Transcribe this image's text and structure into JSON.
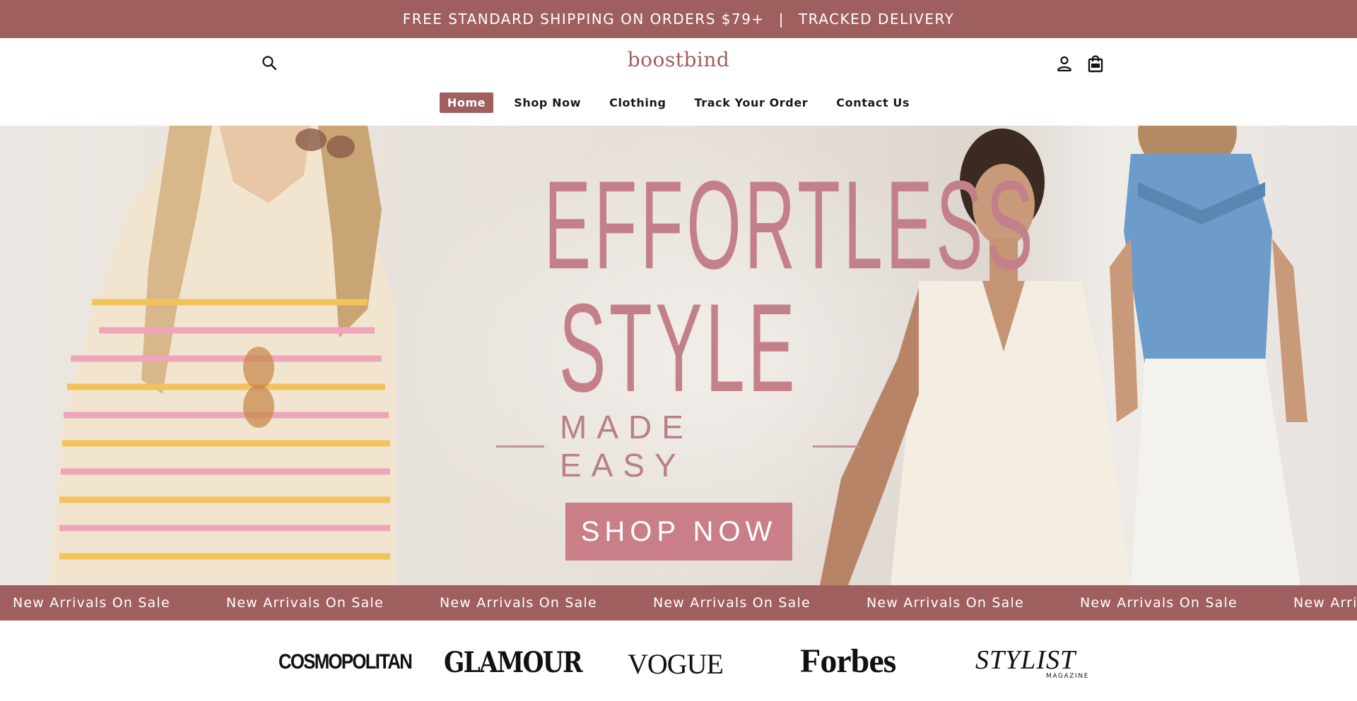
{
  "announcement": {
    "left": "FREE STANDARD SHIPPING ON ORDERS $79+",
    "separator": "|",
    "right": "TRACKED DELIVERY"
  },
  "header": {
    "logo": "boostbind",
    "icons": {
      "search": "search-icon",
      "account": "user-icon",
      "cart": "shopping-bag-icon"
    }
  },
  "nav": {
    "items": [
      {
        "label": "Home",
        "active": true
      },
      {
        "label": "Shop Now",
        "active": false
      },
      {
        "label": "Clothing",
        "active": false
      },
      {
        "label": "Track Your Order",
        "active": false
      },
      {
        "label": "Contact Us",
        "active": false
      }
    ]
  },
  "hero": {
    "line1": "EFFORTLESS",
    "line2": "STYLE",
    "subtitle": "MADE EASY",
    "cta": "SHOP NOW"
  },
  "marquee": {
    "items": [
      "New Arrivals On Sale",
      "New Arrivals On Sale",
      "New Arrivals On Sale",
      "New Arrivals On Sale",
      "New Arrivals On Sale",
      "New Arrivals On Sale",
      "New Arrivals On Sale"
    ]
  },
  "press": {
    "logos": [
      "COSMOPOLITAN",
      "GLAMOUR",
      "VOGUE",
      "Forbes",
      "STYLIST"
    ],
    "stylist_sub": "MAGAZINE"
  },
  "colors": {
    "brand": "#a05f5f",
    "hero_text": "#c4808a",
    "cta": "#c97e88"
  }
}
